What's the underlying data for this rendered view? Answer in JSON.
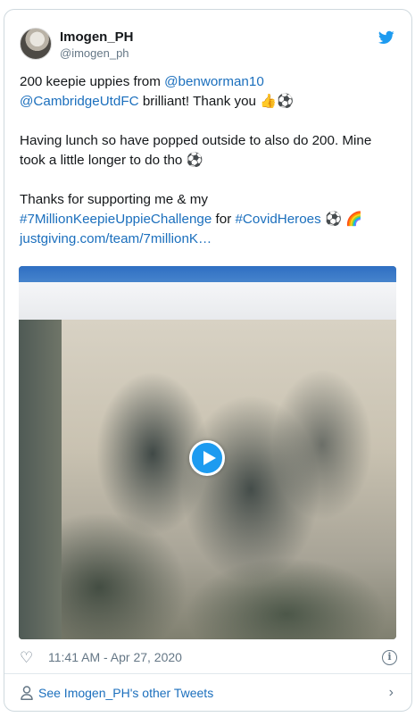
{
  "author": {
    "name": "Imogen_PH",
    "handle": "@imogen_ph"
  },
  "tweet": {
    "lines": [
      {
        "t1": "200 keepie uppies from ",
        "l1": "@benworman10"
      },
      {
        "l1": "@CambridgeUtdFC",
        "t1": " brilliant! Thank you 👍⚽"
      },
      {
        "t1": "Having lunch so have popped outside to also do 200. Mine"
      },
      {
        "t1": "took a little longer to do tho ⚽"
      },
      {
        "t1": "Thanks for supporting me & my"
      },
      {
        "l1": "#7MillionKeepieUppieChallenge",
        "t1": " for ",
        "l2": "#CovidHeroes",
        "t2": " ⚽ 🌈"
      },
      {
        "l1": "justgiving.com/team/7millionK…"
      }
    ]
  },
  "meta": {
    "timestamp": "11:41 AM - Apr 27, 2020",
    "info_glyph": "i"
  },
  "footer": {
    "label": "See Imogen_PH's other Tweets",
    "chevron": "›"
  },
  "icons": {
    "heart": "♡"
  },
  "colors": {
    "link": "#1b6fbd",
    "twitter_blue": "#1d9bf0",
    "muted": "#657786"
  }
}
